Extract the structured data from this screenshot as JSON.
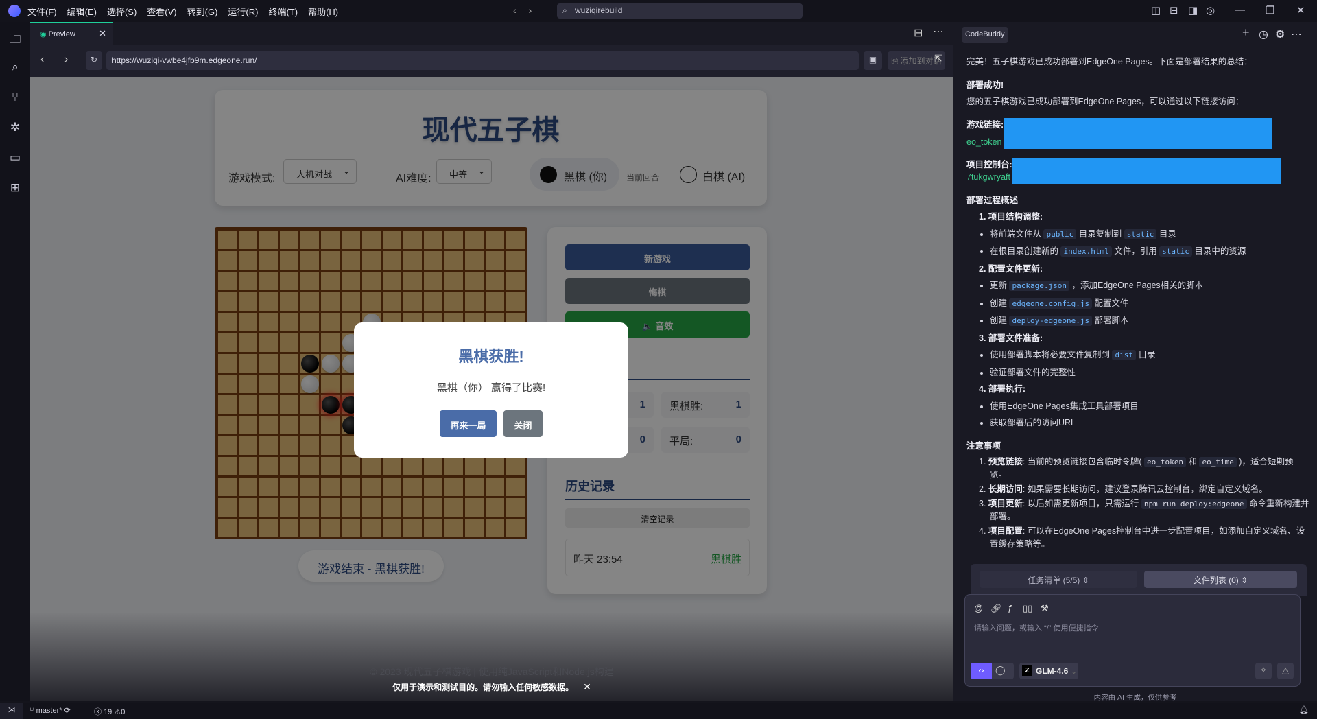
{
  "menubar": {
    "items": [
      "文件(F)",
      "编辑(E)",
      "选择(S)",
      "查看(V)",
      "转到(G)",
      "运行(R)",
      "终端(T)",
      "帮助(H)"
    ],
    "search": "wuziqirebuild"
  },
  "editor": {
    "tab_label": "Preview",
    "url": "https://wuziqi-vwbe4jfb9m.edgeone.run/",
    "add_to_chat": "添加到对话"
  },
  "game": {
    "title": "现代五子棋",
    "mode_label": "游戏模式:",
    "mode_value": "人机对战",
    "ai_label": "AI难度:",
    "ai_value": "中等",
    "black_player": "黑棋 (你)",
    "current_turn": "当前回合",
    "white_player": "白棋 (AI)",
    "buttons": {
      "new_game": "新游戏",
      "undo": "悔棋",
      "sound": "音效"
    },
    "stats": {
      "left_top_value": "1",
      "left_bottom_value": "0",
      "black_wins_label": "黑棋胜:",
      "black_wins": "1",
      "draws_label": "平局:",
      "draws": "0"
    },
    "history_title": "历史记录",
    "clear_history": "清空记录",
    "history": [
      {
        "time": "昨天 23:54",
        "result": "黑棋胜"
      }
    ],
    "status": "游戏结束 - 黑棋获胜!",
    "footer": "© 2023 现代五子棋游戏 | 使用纯JavaScript和Node.js构建",
    "notice": "仅用于演示和测试目的。请勿输入任何敏感数据。",
    "board_size": 15,
    "stones": [
      {
        "c": 7,
        "r": 4,
        "p": "w"
      },
      {
        "c": 6,
        "r": 5,
        "p": "w"
      },
      {
        "c": 7,
        "r": 5,
        "p": "w"
      },
      {
        "c": 4,
        "r": 6,
        "p": "b"
      },
      {
        "c": 5,
        "r": 6,
        "p": "w"
      },
      {
        "c": 6,
        "r": 6,
        "p": "w"
      },
      {
        "c": 4,
        "r": 7,
        "p": "w"
      },
      {
        "c": 5,
        "r": 8,
        "p": "b",
        "win": true
      },
      {
        "c": 6,
        "r": 8,
        "p": "b",
        "win": true
      },
      {
        "c": 7,
        "r": 8,
        "p": "b",
        "win": true
      },
      {
        "c": 8,
        "r": 8,
        "p": "b",
        "win": true
      },
      {
        "c": 9,
        "r": 8,
        "p": "b",
        "win": true
      },
      {
        "c": 6,
        "r": 9,
        "p": "b"
      }
    ]
  },
  "dialog": {
    "title": "黑棋获胜!",
    "message": "黑棋（你） 赢得了比赛!",
    "again": "再来一局",
    "close": "关闭"
  },
  "assistant": {
    "tag": "CodeBuddy",
    "intro": "完美！五子棋游戏已成功部署到EdgeOne Pages。下面是部署结果的总结：",
    "success_title": "部署成功!",
    "success_text": "您的五子棋游戏已成功部署到EdgeOne Pages，可以通过以下链接访问：",
    "game_link_label": "游戏链接:",
    "game_link_partial": "eo_token=",
    "console_label": "项目控制台:",
    "console_partial": "7tukgwryaft",
    "process_title": "部署过程概述",
    "steps": [
      {
        "title": "项目结构调整:",
        "items": [
          [
            "将前端文件从 ",
            {
              "code": "public"
            },
            " 目录复制到 ",
            {
              "code": "static"
            },
            " 目录"
          ],
          [
            "在根目录创建新的 ",
            {
              "code": "index.html"
            },
            " 文件，引用 ",
            {
              "code": "static"
            },
            " 目录中的资源"
          ]
        ]
      },
      {
        "title": "配置文件更新:",
        "items": [
          [
            "更新 ",
            {
              "code": "package.json"
            },
            " ，添加EdgeOne Pages相关的脚本"
          ],
          [
            "创建 ",
            {
              "code": "edgeone.config.js"
            },
            " 配置文件"
          ],
          [
            "创建 ",
            {
              "code": "deploy-edgeone.js"
            },
            " 部署脚本"
          ]
        ]
      },
      {
        "title": "部署文件准备:",
        "items": [
          [
            "使用部署脚本将必要文件复制到 ",
            {
              "code": "dist"
            },
            " 目录"
          ],
          [
            "验证部署文件的完整性"
          ]
        ]
      },
      {
        "title": "部署执行:",
        "items": [
          [
            "使用EdgeOne Pages集成工具部署项目"
          ],
          [
            "获取部署后的访问URL"
          ]
        ]
      }
    ],
    "notes_title": "注意事项",
    "notes": [
      {
        "title": "预览链接",
        "text": [
          ": 当前的预览链接包含临时令牌( ",
          {
            "code": "eo_token"
          },
          " 和 ",
          {
            "code": "eo_time"
          },
          " )，适合短期预览。"
        ]
      },
      {
        "title": "长期访问",
        "text": [
          ": 如果需要长期访问，建议登录腾讯云控制台，绑定自定义域名。"
        ]
      },
      {
        "title": "项目更新",
        "text": [
          ": 以后如需更新项目，只需运行 ",
          {
            "code": "npm run deploy:edgeone"
          },
          " 命令重新构建并部署。"
        ]
      },
      {
        "title": "项目配置",
        "text": [
          ": 可以在EdgeOne Pages控制台中进一步配置项目，如添加自定义域名、设置缓存策略等。"
        ]
      }
    ],
    "task_list": "任务清单 (5/5)",
    "file_list": "文件列表 (0)",
    "input_placeholder": "请输入问题，或输入 “/” 使用便捷指令",
    "model": "GLM-4.6",
    "disclaimer": "内容由 AI 生成，仅供参考"
  },
  "statusbar": {
    "branch": "master*",
    "errors": "19",
    "warnings": "0"
  },
  "colors": {
    "accent": "#1fcf9a",
    "redaction": "#2196f3",
    "board": "#e8c07a",
    "dialog_primary": "#4a6ca8"
  }
}
